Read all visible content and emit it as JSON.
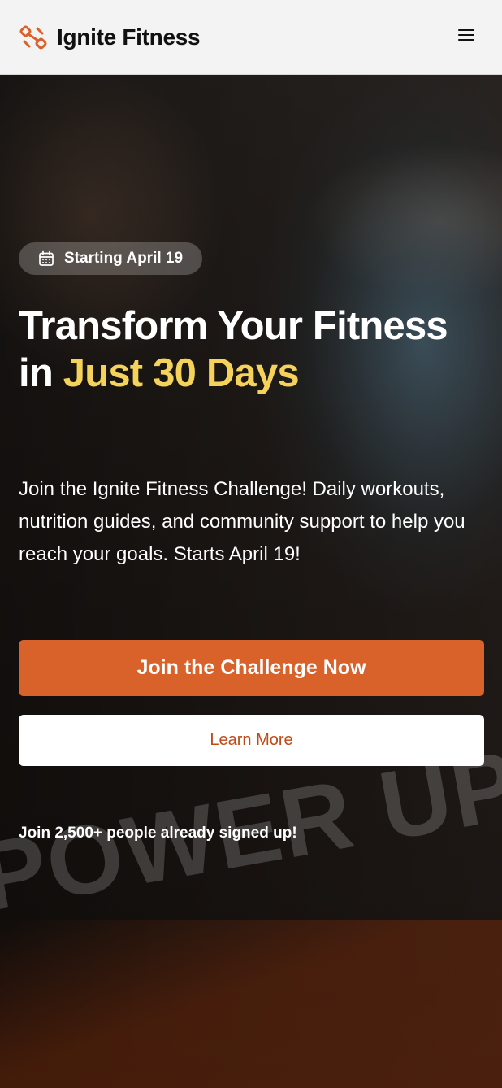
{
  "header": {
    "brand_name": "Ignite Fitness",
    "logo_icon": "dumbbell-icon",
    "menu_icon": "hamburger-menu-icon"
  },
  "hero": {
    "badge": {
      "icon": "calendar-icon",
      "text": "Starting April 19"
    },
    "headline": {
      "part1": "Transform Your Fitness in ",
      "accent": "Just 30 Days"
    },
    "description": "Join the Ignite Fitness Challenge! Daily workouts, nutrition guides, and community support to help you reach your goals. Starts April 19!",
    "primary_cta": "Join the Challenge Now",
    "secondary_cta": "Learn More",
    "signup_note": "Join 2,500+ people already signed up!",
    "background_word": "POWER UP"
  },
  "colors": {
    "brand_orange": "#d9622b",
    "accent_yellow": "#f5d35a",
    "learn_more_text": "#c04a17"
  }
}
